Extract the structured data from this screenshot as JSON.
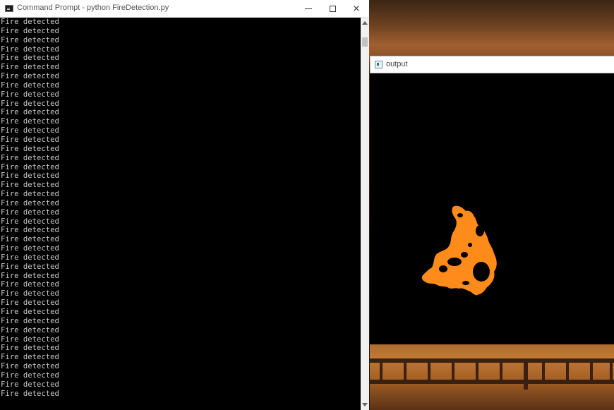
{
  "cmd_window": {
    "title": "Command Prompt - python  FireDetection.py",
    "lines": [
      "Fire detected",
      "Fire detected",
      "Fire detected",
      "Fire detected",
      "Fire detected",
      "Fire detected",
      "Fire detected",
      "Fire detected",
      "Fire detected",
      "Fire detected",
      "Fire detected",
      "Fire detected",
      "Fire detected",
      "Fire detected",
      "Fire detected",
      "Fire detected",
      "Fire detected",
      "Fire detected",
      "Fire detected",
      "Fire detected",
      "Fire detected",
      "Fire detected",
      "Fire detected",
      "Fire detected",
      "Fire detected",
      "Fire detected",
      "Fire detected",
      "Fire detected",
      "Fire detected",
      "Fire detected",
      "Fire detected",
      "Fire detected",
      "Fire detected",
      "Fire detected",
      "Fire detected",
      "Fire detected",
      "Fire detected",
      "Fire detected",
      "Fire detected",
      "Fire detected",
      "Fire detected",
      "Fire detected"
    ],
    "buttons": {
      "minimize": "minimize",
      "maximize": "maximize",
      "close": "×"
    }
  },
  "output_window": {
    "title": "output",
    "fire_color": "#ff8c1a"
  }
}
